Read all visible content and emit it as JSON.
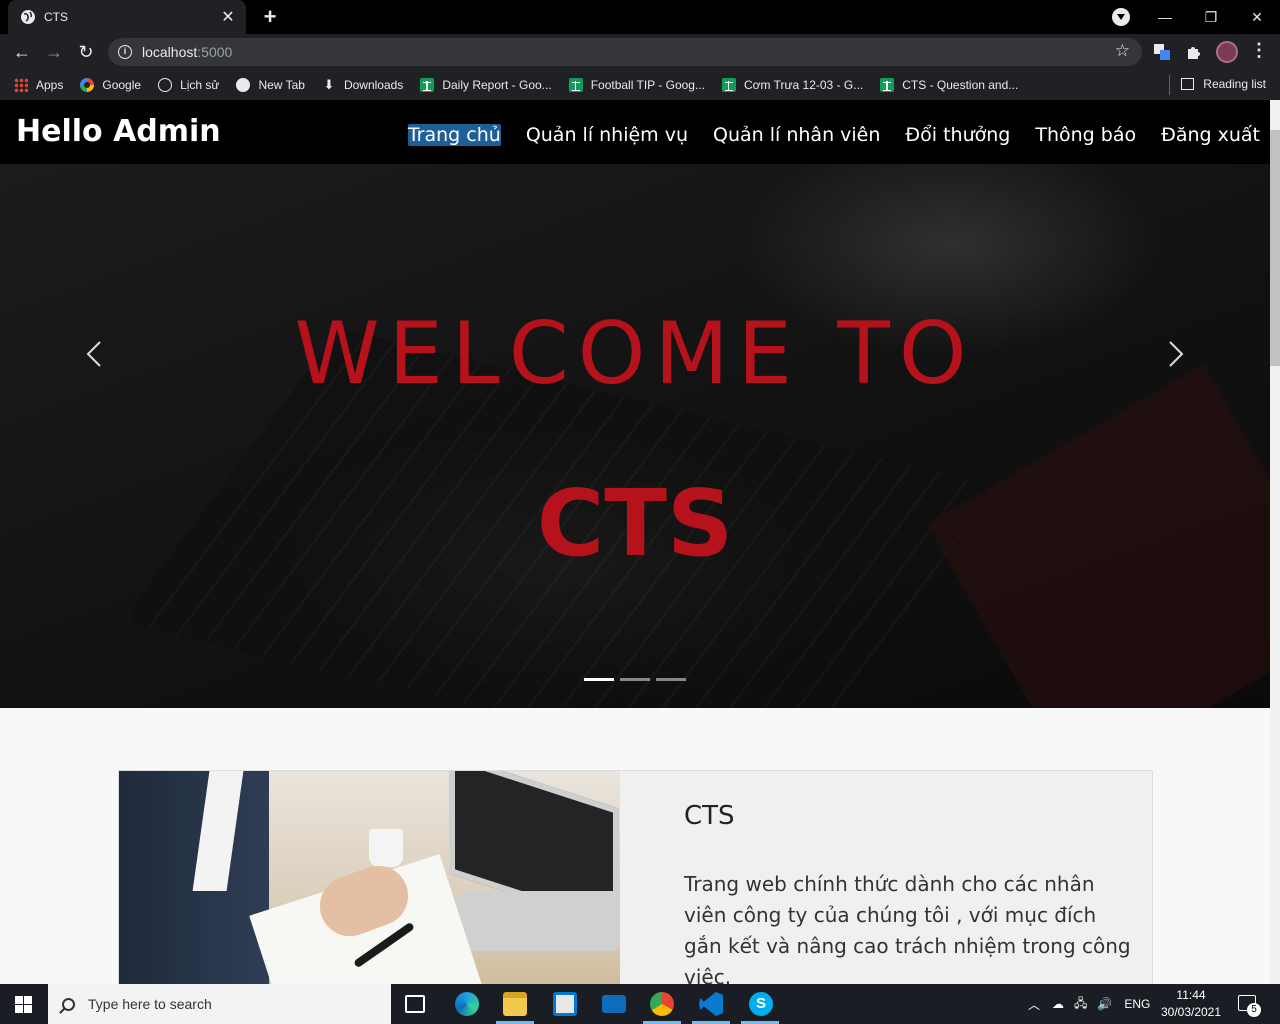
{
  "browser": {
    "tab_title": "CTS",
    "url_host": "localhost",
    "url_port": ":5000",
    "bookmarks": [
      {
        "label": "Apps",
        "icon": "apps-grid-icon"
      },
      {
        "label": "Google",
        "icon": "google-icon"
      },
      {
        "label": "Lịch sử",
        "icon": "history-icon"
      },
      {
        "label": "New Tab",
        "icon": "globe-icon"
      },
      {
        "label": "Downloads",
        "icon": "download-icon"
      },
      {
        "label": "Daily Report - Goo...",
        "icon": "sheets-icon"
      },
      {
        "label": "Football TIP - Goog...",
        "icon": "sheets-icon"
      },
      {
        "label": "Cơm Trưa 12-03 - G...",
        "icon": "sheets-icon"
      },
      {
        "label": "CTS - Question and...",
        "icon": "sheets-icon"
      }
    ],
    "reading_list": "Reading list"
  },
  "site": {
    "brand": "Hello Admin",
    "menu": [
      {
        "label": "Trang chủ",
        "active": true
      },
      {
        "label": "Quản lí nhiệm vụ"
      },
      {
        "label": "Quản lí nhân viên"
      },
      {
        "label": "Đổi thưởng"
      },
      {
        "label": "Thông báo"
      },
      {
        "label": "Đăng xuất"
      }
    ],
    "hero": {
      "line1": "WELCOME TO",
      "line2": "CTS",
      "slide_count": 3,
      "active_slide": 1,
      "text_color": "#b5121b"
    },
    "card": {
      "title": "CTS",
      "text": "Trang web chính thức dành cho các nhân viên công ty của chúng tôi , với mục đích gắn kết và nâng cao trách nhiệm trong công việc."
    }
  },
  "taskbar": {
    "search_placeholder": "Type here to search",
    "language": "ENG",
    "time": "11:44",
    "date": "30/03/2021",
    "notification_count": "5"
  }
}
